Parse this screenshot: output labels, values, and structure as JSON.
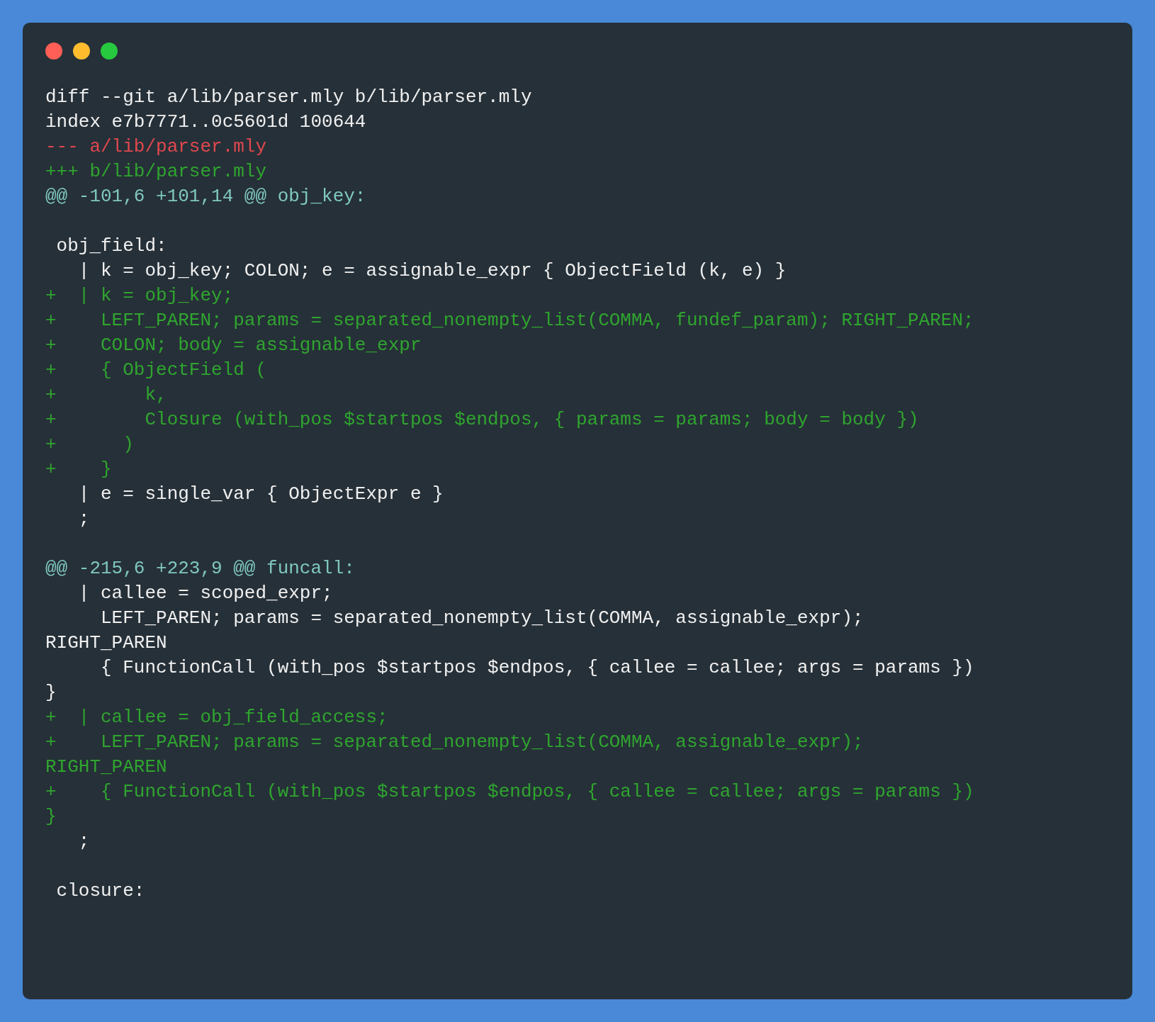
{
  "window": {
    "buttons": [
      {
        "kind": "close"
      },
      {
        "kind": "minimize"
      },
      {
        "kind": "maximize"
      }
    ]
  },
  "lines": [
    {
      "kind": "meta",
      "text": "diff --git a/lib/parser.mly b/lib/parser.mly"
    },
    {
      "kind": "meta",
      "text": "index e7b7771..0c5601d 100644"
    },
    {
      "kind": "del",
      "text": "--- a/lib/parser.mly"
    },
    {
      "kind": "add",
      "text": "+++ b/lib/parser.mly"
    },
    {
      "kind": "hunk",
      "text": "@@ -101,6 +101,14 @@ obj_key:"
    },
    {
      "kind": "blank"
    },
    {
      "kind": "ctx",
      "text": " obj_field:"
    },
    {
      "kind": "ctx",
      "text": "   | k = obj_key; COLON; e = assignable_expr { ObjectField (k, e) }"
    },
    {
      "kind": "add",
      "text": "+  | k = obj_key;"
    },
    {
      "kind": "add",
      "text": "+    LEFT_PAREN; params = separated_nonempty_list(COMMA, fundef_param); RIGHT_PAREN;"
    },
    {
      "kind": "add",
      "text": "+    COLON; body = assignable_expr"
    },
    {
      "kind": "add",
      "text": "+    { ObjectField ("
    },
    {
      "kind": "add",
      "text": "+        k,"
    },
    {
      "kind": "add",
      "text": "+        Closure (with_pos $startpos $endpos, { params = params; body = body })"
    },
    {
      "kind": "add",
      "text": "+      )"
    },
    {
      "kind": "add",
      "text": "+    }"
    },
    {
      "kind": "ctx",
      "text": "   | e = single_var { ObjectExpr e }"
    },
    {
      "kind": "ctx",
      "text": "   ;"
    },
    {
      "kind": "blank"
    },
    {
      "kind": "hunk",
      "text": "@@ -215,6 +223,9 @@ funcall:"
    },
    {
      "kind": "ctx",
      "text": "   | callee = scoped_expr;"
    },
    {
      "kind": "ctx",
      "text": "     LEFT_PAREN; params = separated_nonempty_list(COMMA, assignable_expr);"
    },
    {
      "kind": "ctx",
      "text": "RIGHT_PAREN"
    },
    {
      "kind": "ctx",
      "text": "     { FunctionCall (with_pos $startpos $endpos, { callee = callee; args = params })"
    },
    {
      "kind": "ctx",
      "text": "}"
    },
    {
      "kind": "add",
      "text": "+  | callee = obj_field_access;"
    },
    {
      "kind": "add",
      "text": "+    LEFT_PAREN; params = separated_nonempty_list(COMMA, assignable_expr);"
    },
    {
      "kind": "add",
      "text": "RIGHT_PAREN"
    },
    {
      "kind": "add",
      "text": "+    { FunctionCall (with_pos $startpos $endpos, { callee = callee; args = params })"
    },
    {
      "kind": "add",
      "text": "}"
    },
    {
      "kind": "ctx",
      "text": "   ;"
    },
    {
      "kind": "blank"
    },
    {
      "kind": "ctx",
      "text": " closure:"
    }
  ]
}
